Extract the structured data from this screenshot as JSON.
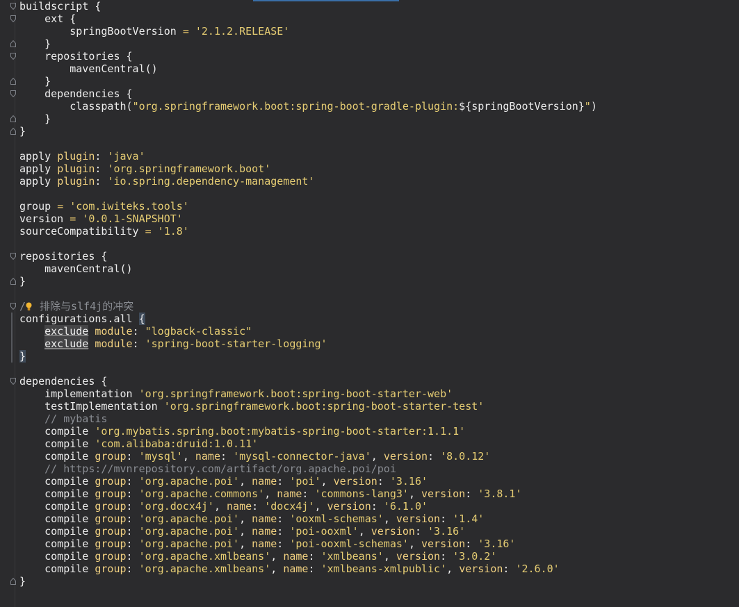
{
  "editor": {
    "language": "gradle",
    "colors": {
      "background": "#2b2b2d",
      "text": "#ececec",
      "string": "#e6cd73",
      "keyword": "#f0d080",
      "operator": "#e4c36a",
      "comment": "#8a8d93",
      "bulb": "#f2b632"
    }
  },
  "lines": [
    {
      "fold": "open",
      "tokens": [
        {
          "t": "buildscript {",
          "c": "id"
        }
      ]
    },
    {
      "fold": "open",
      "tokens": [
        {
          "t": "    ext {",
          "c": "id"
        }
      ]
    },
    {
      "tokens": [
        {
          "t": "        springBootVersion ",
          "c": "id"
        },
        {
          "t": "=",
          "c": "op"
        },
        {
          "t": " '2.1.2.RELEASE'",
          "c": "str"
        }
      ]
    },
    {
      "fold": "close",
      "tokens": [
        {
          "t": "    }",
          "c": "id"
        }
      ]
    },
    {
      "fold": "open",
      "tokens": [
        {
          "t": "    repositories {",
          "c": "id"
        }
      ]
    },
    {
      "tokens": [
        {
          "t": "        mavenCentral()",
          "c": "id"
        }
      ]
    },
    {
      "fold": "close",
      "tokens": [
        {
          "t": "    }",
          "c": "id"
        }
      ]
    },
    {
      "fold": "open",
      "tokens": [
        {
          "t": "    dependencies {",
          "c": "id"
        }
      ]
    },
    {
      "tokens": [
        {
          "t": "        classpath(",
          "c": "id"
        },
        {
          "t": "\"org.springframework.boot:spring-boot-gradle-plugin:",
          "c": "str"
        },
        {
          "t": "${springBootVersion}",
          "c": "id"
        },
        {
          "t": "\"",
          "c": "str"
        },
        {
          "t": ")",
          "c": "id"
        }
      ]
    },
    {
      "fold": "close",
      "tokens": [
        {
          "t": "    }",
          "c": "id"
        }
      ]
    },
    {
      "fold": "close",
      "tokens": [
        {
          "t": "}",
          "c": "id"
        }
      ]
    },
    {
      "tokens": []
    },
    {
      "tokens": [
        {
          "t": "apply ",
          "c": "id"
        },
        {
          "t": "plugin",
          "c": "kw"
        },
        {
          "t": ": ",
          "c": "id"
        },
        {
          "t": "'java'",
          "c": "str"
        }
      ]
    },
    {
      "tokens": [
        {
          "t": "apply ",
          "c": "id"
        },
        {
          "t": "plugin",
          "c": "kw"
        },
        {
          "t": ": ",
          "c": "id"
        },
        {
          "t": "'org.springframework.boot'",
          "c": "str"
        }
      ]
    },
    {
      "tokens": [
        {
          "t": "apply ",
          "c": "id"
        },
        {
          "t": "plugin",
          "c": "kw"
        },
        {
          "t": ": ",
          "c": "id"
        },
        {
          "t": "'io.spring.dependency-management'",
          "c": "str"
        }
      ]
    },
    {
      "tokens": []
    },
    {
      "tokens": [
        {
          "t": "group ",
          "c": "id"
        },
        {
          "t": "=",
          "c": "op"
        },
        {
          "t": " 'com.iwiteks.tools'",
          "c": "str"
        }
      ]
    },
    {
      "tokens": [
        {
          "t": "version ",
          "c": "id"
        },
        {
          "t": "=",
          "c": "op"
        },
        {
          "t": " '0.0.1-SNAPSHOT'",
          "c": "str"
        }
      ]
    },
    {
      "tokens": [
        {
          "t": "sourceCompatibility ",
          "c": "id"
        },
        {
          "t": "=",
          "c": "op"
        },
        {
          "t": " '1.8'",
          "c": "str"
        }
      ]
    },
    {
      "tokens": []
    },
    {
      "fold": "open",
      "tokens": [
        {
          "t": "repositories {",
          "c": "id"
        }
      ]
    },
    {
      "tokens": [
        {
          "t": "    mavenCentral()",
          "c": "id"
        }
      ]
    },
    {
      "fold": "close",
      "tokens": [
        {
          "t": "}",
          "c": "id"
        }
      ]
    },
    {
      "tokens": []
    },
    {
      "fold": "open",
      "tokens": [
        {
          "t": "/",
          "c": "com"
        },
        {
          "t": "bulb",
          "c": "bulb"
        },
        {
          "t": " 排除与slf4j的冲突",
          "c": "com"
        }
      ]
    },
    {
      "tokens": [
        {
          "t": "configurations.all ",
          "c": "id"
        },
        {
          "t": "{",
          "c": "brace"
        }
      ]
    },
    {
      "tokens": [
        {
          "t": "    ",
          "c": "id"
        },
        {
          "t": "exclude",
          "c": "ex"
        },
        {
          "t": " module",
          "c": "kw"
        },
        {
          "t": ": ",
          "c": "id"
        },
        {
          "t": "\"logback-classic\"",
          "c": "str"
        }
      ]
    },
    {
      "tokens": [
        {
          "t": "    ",
          "c": "id"
        },
        {
          "t": "exclude",
          "c": "ex"
        },
        {
          "t": " module",
          "c": "kw"
        },
        {
          "t": ": ",
          "c": "id"
        },
        {
          "t": "'spring-boot-starter-logging'",
          "c": "str"
        }
      ]
    },
    {
      "tokens": [
        {
          "t": "}",
          "c": "brace"
        }
      ]
    },
    {
      "tokens": []
    },
    {
      "fold": "open",
      "tokens": [
        {
          "t": "dependencies {",
          "c": "id"
        }
      ]
    },
    {
      "tokens": [
        {
          "t": "    implementation ",
          "c": "id"
        },
        {
          "t": "'org.springframework.boot:spring-boot-starter-web'",
          "c": "str"
        }
      ]
    },
    {
      "tokens": [
        {
          "t": "    testImplementation ",
          "c": "id"
        },
        {
          "t": "'org.springframework.boot:spring-boot-starter-test'",
          "c": "str"
        }
      ]
    },
    {
      "tokens": [
        {
          "t": "    // mybatis",
          "c": "com"
        }
      ]
    },
    {
      "tokens": [
        {
          "t": "    compile ",
          "c": "id"
        },
        {
          "t": "'org.mybatis.spring.boot:mybatis-spring-boot-starter:1.1.1'",
          "c": "str"
        }
      ]
    },
    {
      "tokens": [
        {
          "t": "    compile ",
          "c": "id"
        },
        {
          "t": "'com.alibaba:druid:1.0.11'",
          "c": "str"
        }
      ]
    },
    {
      "tokens": [
        {
          "t": "    compile ",
          "c": "id"
        },
        {
          "t": "group",
          "c": "kw"
        },
        {
          "t": ": ",
          "c": "id"
        },
        {
          "t": "'mysql'",
          "c": "str"
        },
        {
          "t": ", ",
          "c": "id"
        },
        {
          "t": "name",
          "c": "kw"
        },
        {
          "t": ": ",
          "c": "id"
        },
        {
          "t": "'mysql-connector-java'",
          "c": "str"
        },
        {
          "t": ", ",
          "c": "id"
        },
        {
          "t": "version",
          "c": "kw"
        },
        {
          "t": ": ",
          "c": "id"
        },
        {
          "t": "'8.0.12'",
          "c": "str"
        }
      ]
    },
    {
      "tokens": [
        {
          "t": "    // https://mvnrepository.com/artifact/org.apache.poi/poi",
          "c": "com"
        }
      ]
    },
    {
      "tokens": [
        {
          "t": "    compile ",
          "c": "id"
        },
        {
          "t": "group",
          "c": "kw"
        },
        {
          "t": ": ",
          "c": "id"
        },
        {
          "t": "'org.apache.poi'",
          "c": "str"
        },
        {
          "t": ", ",
          "c": "id"
        },
        {
          "t": "name",
          "c": "kw"
        },
        {
          "t": ": ",
          "c": "id"
        },
        {
          "t": "'poi'",
          "c": "str"
        },
        {
          "t": ", ",
          "c": "id"
        },
        {
          "t": "version",
          "c": "kw"
        },
        {
          "t": ": ",
          "c": "id"
        },
        {
          "t": "'3.16'",
          "c": "str"
        }
      ]
    },
    {
      "tokens": [
        {
          "t": "    compile ",
          "c": "id"
        },
        {
          "t": "group",
          "c": "kw"
        },
        {
          "t": ": ",
          "c": "id"
        },
        {
          "t": "'org.apache.commons'",
          "c": "str"
        },
        {
          "t": ", ",
          "c": "id"
        },
        {
          "t": "name",
          "c": "kw"
        },
        {
          "t": ": ",
          "c": "id"
        },
        {
          "t": "'commons-lang3'",
          "c": "str"
        },
        {
          "t": ", ",
          "c": "id"
        },
        {
          "t": "version",
          "c": "kw"
        },
        {
          "t": ": ",
          "c": "id"
        },
        {
          "t": "'3.8.1'",
          "c": "str"
        }
      ]
    },
    {
      "tokens": [
        {
          "t": "    compile ",
          "c": "id"
        },
        {
          "t": "group",
          "c": "kw"
        },
        {
          "t": ": ",
          "c": "id"
        },
        {
          "t": "'org.docx4j'",
          "c": "str"
        },
        {
          "t": ", ",
          "c": "id"
        },
        {
          "t": "name",
          "c": "kw"
        },
        {
          "t": ": ",
          "c": "id"
        },
        {
          "t": "'docx4j'",
          "c": "str"
        },
        {
          "t": ", ",
          "c": "id"
        },
        {
          "t": "version",
          "c": "kw"
        },
        {
          "t": ": ",
          "c": "id"
        },
        {
          "t": "'6.1.0'",
          "c": "str"
        }
      ]
    },
    {
      "tokens": [
        {
          "t": "    compile ",
          "c": "id"
        },
        {
          "t": "group",
          "c": "kw"
        },
        {
          "t": ": ",
          "c": "id"
        },
        {
          "t": "'org.apache.poi'",
          "c": "str"
        },
        {
          "t": ", ",
          "c": "id"
        },
        {
          "t": "name",
          "c": "kw"
        },
        {
          "t": ": ",
          "c": "id"
        },
        {
          "t": "'ooxml-schemas'",
          "c": "str"
        },
        {
          "t": ", ",
          "c": "id"
        },
        {
          "t": "version",
          "c": "kw"
        },
        {
          "t": ": ",
          "c": "id"
        },
        {
          "t": "'1.4'",
          "c": "str"
        }
      ]
    },
    {
      "tokens": [
        {
          "t": "    compile ",
          "c": "id"
        },
        {
          "t": "group",
          "c": "kw"
        },
        {
          "t": ": ",
          "c": "id"
        },
        {
          "t": "'org.apache.poi'",
          "c": "str"
        },
        {
          "t": ", ",
          "c": "id"
        },
        {
          "t": "name",
          "c": "kw"
        },
        {
          "t": ": ",
          "c": "id"
        },
        {
          "t": "'poi-ooxml'",
          "c": "str"
        },
        {
          "t": ", ",
          "c": "id"
        },
        {
          "t": "version",
          "c": "kw"
        },
        {
          "t": ": ",
          "c": "id"
        },
        {
          "t": "'3.16'",
          "c": "str"
        }
      ]
    },
    {
      "tokens": [
        {
          "t": "    compile ",
          "c": "id"
        },
        {
          "t": "group",
          "c": "kw"
        },
        {
          "t": ": ",
          "c": "id"
        },
        {
          "t": "'org.apache.poi'",
          "c": "str"
        },
        {
          "t": ", ",
          "c": "id"
        },
        {
          "t": "name",
          "c": "kw"
        },
        {
          "t": ": ",
          "c": "id"
        },
        {
          "t": "'poi-ooxml-schemas'",
          "c": "str"
        },
        {
          "t": ", ",
          "c": "id"
        },
        {
          "t": "version",
          "c": "kw"
        },
        {
          "t": ": ",
          "c": "id"
        },
        {
          "t": "'3.16'",
          "c": "str"
        }
      ]
    },
    {
      "tokens": [
        {
          "t": "    compile ",
          "c": "id"
        },
        {
          "t": "group",
          "c": "kw"
        },
        {
          "t": ": ",
          "c": "id"
        },
        {
          "t": "'org.apache.xmlbeans'",
          "c": "str"
        },
        {
          "t": ", ",
          "c": "id"
        },
        {
          "t": "name",
          "c": "kw"
        },
        {
          "t": ": ",
          "c": "id"
        },
        {
          "t": "'xmlbeans'",
          "c": "str"
        },
        {
          "t": ", ",
          "c": "id"
        },
        {
          "t": "version",
          "c": "kw"
        },
        {
          "t": ": ",
          "c": "id"
        },
        {
          "t": "'3.0.2'",
          "c": "str"
        }
      ]
    },
    {
      "tokens": [
        {
          "t": "    compile ",
          "c": "id"
        },
        {
          "t": "group",
          "c": "kw"
        },
        {
          "t": ": ",
          "c": "id"
        },
        {
          "t": "'org.apache.xmlbeans'",
          "c": "str"
        },
        {
          "t": ", ",
          "c": "id"
        },
        {
          "t": "name",
          "c": "kw"
        },
        {
          "t": ": ",
          "c": "id"
        },
        {
          "t": "'xmlbeans-xmlpublic'",
          "c": "str"
        },
        {
          "t": ", ",
          "c": "id"
        },
        {
          "t": "version",
          "c": "kw"
        },
        {
          "t": ": ",
          "c": "id"
        },
        {
          "t": "'2.6.0'",
          "c": "str"
        }
      ]
    },
    {
      "fold": "close",
      "tokens": [
        {
          "t": "}",
          "c": "id"
        }
      ]
    }
  ]
}
